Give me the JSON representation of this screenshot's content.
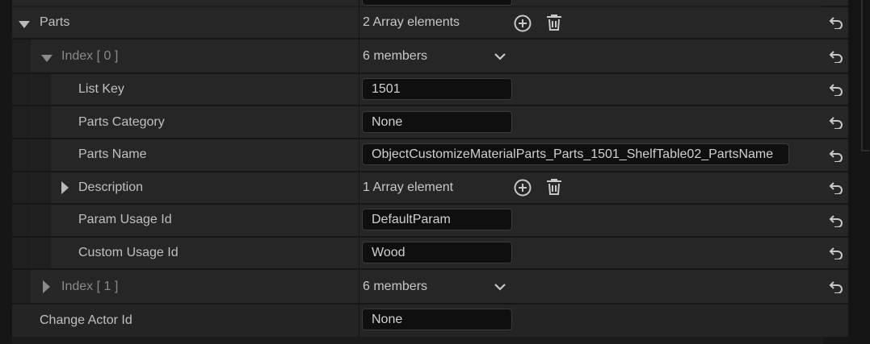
{
  "rows": {
    "parts": {
      "label": "Parts",
      "value": "2 Array elements"
    },
    "index0": {
      "label": "Index [ 0 ]",
      "value": "6 members"
    },
    "list_key": {
      "label": "List Key",
      "value": "1501"
    },
    "parts_category": {
      "label": "Parts Category",
      "value": "None"
    },
    "parts_name": {
      "label": "Parts Name",
      "value": "ObjectCustomizeMaterialParts_Parts_1501_ShelfTable02_PartsName"
    },
    "description": {
      "label": "Description",
      "value": "1 Array element"
    },
    "param_usage_id": {
      "label": "Param Usage Id",
      "value": "DefaultParam"
    },
    "custom_usage_id": {
      "label": "Custom Usage Id",
      "value": "Wood"
    },
    "index1": {
      "label": "Index [ 1 ]",
      "value": "6 members"
    },
    "change_actor_id": {
      "label": "Change Actor Id",
      "value": "None"
    }
  },
  "icons": {
    "expanded": "triangle-down-icon",
    "collapsed": "triangle-right-icon",
    "add": "plus-circle-icon",
    "delete": "trash-icon",
    "dropdown": "chevron-down-icon",
    "reset": "reset-arrow-icon"
  },
  "colors": {
    "row_bg": "#262626",
    "field_bg": "#0f0f0f",
    "text": "#c0c0c0",
    "dim_text": "#8a8a8a"
  }
}
